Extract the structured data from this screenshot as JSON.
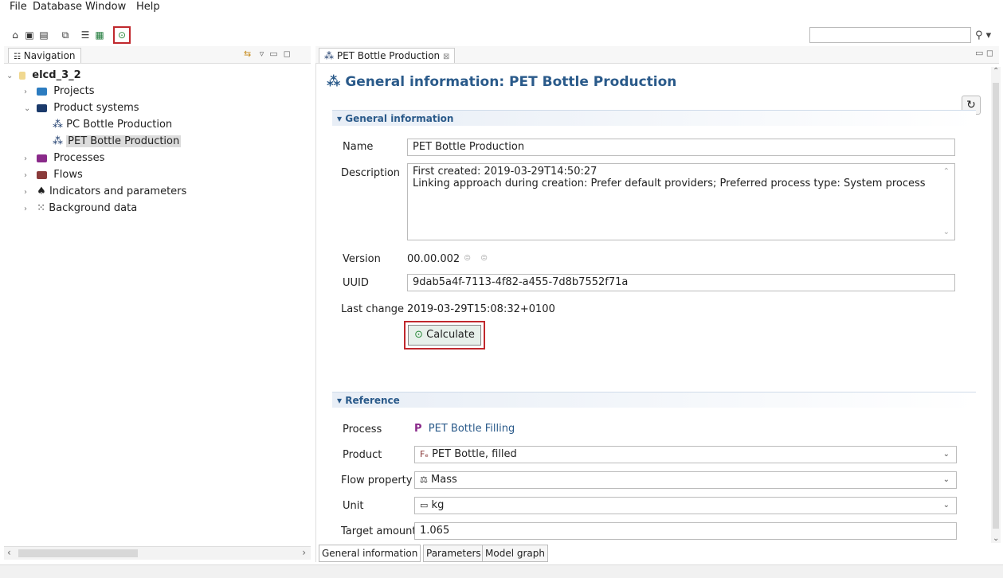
{
  "menu": [
    "File",
    "Database",
    "Window",
    "Help"
  ],
  "toolbar": {
    "icons": [
      "home-icon",
      "save-icon",
      "save-as-icon",
      "save-all-icon",
      "list-icon",
      "excel-icon",
      "calculate-icon"
    ]
  },
  "navigation": {
    "tab_label": "Navigation",
    "tree": [
      {
        "label": "elcd_3_2",
        "level": 0,
        "expanded": true,
        "icon": "database-icon"
      },
      {
        "label": "Projects",
        "level": 1,
        "icon": "folder-icon",
        "color": "#2c7cc0"
      },
      {
        "label": "Product systems",
        "level": 1,
        "expanded": true,
        "icon": "folder-icon",
        "color": "#1b3a6b"
      },
      {
        "label": "PC Bottle Production",
        "level": 2,
        "icon": "product-system-icon"
      },
      {
        "label": "PET Bottle Production",
        "level": 2,
        "icon": "product-system-icon",
        "selected": true
      },
      {
        "label": "Processes",
        "level": 1,
        "icon": "folder-icon",
        "color": "#8a2a8a"
      },
      {
        "label": "Flows",
        "level": 1,
        "icon": "folder-icon",
        "color": "#8a3a3a"
      },
      {
        "label": "Indicators and parameters",
        "level": 1,
        "icon": "indicators-icon"
      },
      {
        "label": "Background data",
        "level": 1,
        "icon": "grid-icon"
      }
    ]
  },
  "editor": {
    "tab_label": "PET Bottle Production",
    "title": "General information: PET Bottle Production",
    "general": {
      "header": "General information",
      "name_label": "Name",
      "name_value": "PET Bottle Production",
      "description_label": "Description",
      "description_line1": "First created: 2019-03-29T14:50:27",
      "description_line2": "Linking approach during creation: Prefer default providers; Preferred process type: System process",
      "version_label": "Version",
      "version_value": "00.00.002",
      "uuid_label": "UUID",
      "uuid_value": "9dab5a4f-7113-4f82-a455-7d8b7552f71a",
      "last_change_label": "Last change",
      "last_change_value": "2019-03-29T15:08:32+0100",
      "calculate_label": "Calculate"
    },
    "reference": {
      "header": "Reference",
      "process_label": "Process",
      "process_value": "PET Bottle Filling",
      "product_label": "Product",
      "product_value": "PET Bottle, filled",
      "flow_property_label": "Flow property",
      "flow_property_value": "Mass",
      "unit_label": "Unit",
      "unit_value": "kg",
      "target_amount_label": "Target amount",
      "target_amount_value": "1.065"
    },
    "bottom_tabs": [
      "General information",
      "Parameters",
      "Model graph"
    ]
  },
  "colors": {
    "title": "#2a5a8a",
    "highlight": "#c0282d",
    "process_icon": "#8a2a8a"
  }
}
